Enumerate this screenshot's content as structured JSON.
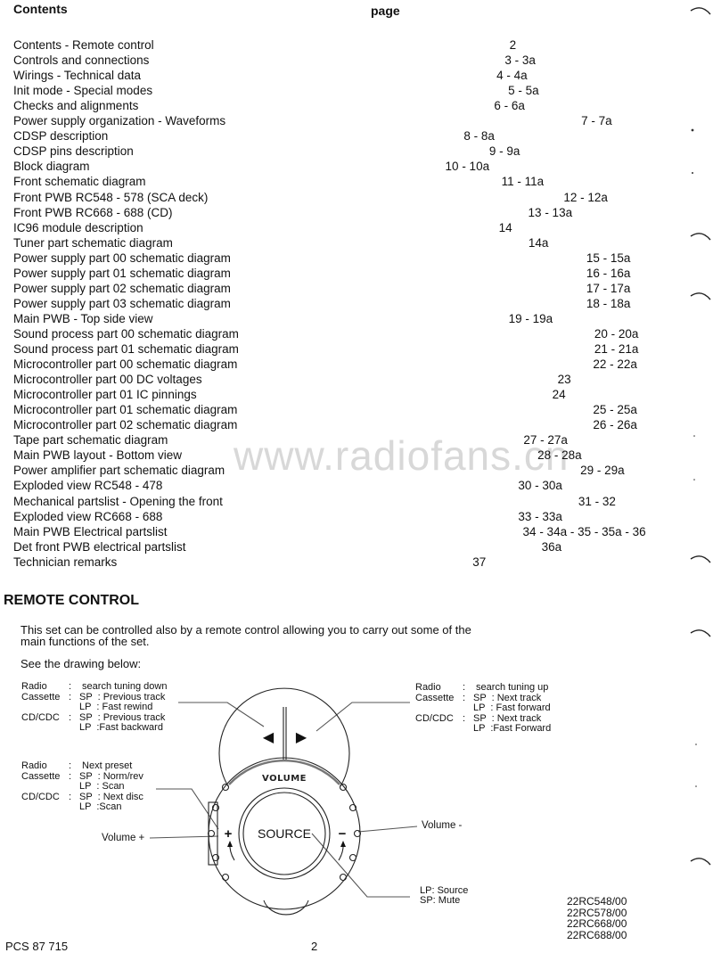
{
  "contents": {
    "heading": "Contents",
    "page_heading": "page",
    "entries": [
      {
        "title": "Contents - Remote control",
        "page": "2"
      },
      {
        "title": "Controls and connections",
        "page": "3 - 3a"
      },
      {
        "title": "Wirings - Technical data",
        "page": "4 - 4a"
      },
      {
        "title": "Init mode - Special modes",
        "page": "5 - 5a"
      },
      {
        "title": "Checks and alignments",
        "page": "6 - 6a"
      },
      {
        "title": "Power supply organization - Waveforms",
        "page": "7 - 7a"
      },
      {
        "title": "CDSP description",
        "page": "8 - 8a"
      },
      {
        "title": "CDSP pins description",
        "page": "9 - 9a"
      },
      {
        "title": "Block diagram",
        "page": "10 - 10a"
      },
      {
        "title": "Front schematic diagram",
        "page": "11 - 11a"
      },
      {
        "title": "Front PWB RC548 - 578 (SCA deck)",
        "page": "12 - 12a"
      },
      {
        "title": "Front PWB RC668 - 688 (CD)",
        "page": "13 - 13a"
      },
      {
        "title": "IC96 module description",
        "page": "14"
      },
      {
        "title": "Tuner part schematic diagram",
        "page": "14a"
      },
      {
        "title": "Power supply part 00 schematic diagram",
        "page": "15 - 15a"
      },
      {
        "title": "Power supply part 01 schematic diagram",
        "page": "16 - 16a"
      },
      {
        "title": "Power supply part 02 schematic diagram",
        "page": "17 - 17a"
      },
      {
        "title": "Power supply part 03 schematic diagram",
        "page": "18 - 18a"
      },
      {
        "title": "Main PWB - Top side view",
        "page": "19 - 19a"
      },
      {
        "title": "Sound process part 00 schematic diagram",
        "page": "20 - 20a"
      },
      {
        "title": "Sound process part 01 schematic diagram",
        "page": "21 - 21a"
      },
      {
        "title": "Microcontroller part 00 schematic diagram",
        "page": "22 - 22a"
      },
      {
        "title": "Microcontroller part 00 DC voltages",
        "page": "23"
      },
      {
        "title": "Microcontroller part 01 IC pinnings",
        "page": "24"
      },
      {
        "title": "Microcontroller part 01 schematic diagram",
        "page": "25 - 25a"
      },
      {
        "title": "Microcontroller part 02 schematic diagram",
        "page": "26 - 26a"
      },
      {
        "title": "Tape part schematic diagram",
        "page": "27 - 27a"
      },
      {
        "title": "Main PWB layout - Bottom view",
        "page": "28 - 28a"
      },
      {
        "title": "Power amplifier part schematic diagram",
        "page": "29 - 29a"
      },
      {
        "title": "Exploded view RC548 - 478",
        "page": "30 - 30a"
      },
      {
        "title": "Mechanical partslist - Opening the front",
        "page": "31 - 32"
      },
      {
        "title": "Exploded view RC668 - 688",
        "page": "33 - 33a"
      },
      {
        "title": "Main PWB Electrical partslist",
        "page": "34 - 34a - 35 - 35a - 36"
      },
      {
        "title": "Det front PWB electrical partslist",
        "page": "36a"
      },
      {
        "title": "Technician remarks",
        "page": "37"
      }
    ]
  },
  "watermark": "www.radiofans.cn",
  "remote": {
    "title": "REMOTE CONTROL",
    "intro_line1": "This set can be controlled also by a remote control allowing you to carry out some of the",
    "intro_line2": "main functions of the set.",
    "see_drawing": "See the drawing below:",
    "drawing": {
      "volume_label": "VOLUME",
      "source_label": "SOURCE",
      "plus_symbol": "+",
      "minus_symbol": "−",
      "prev_symbol": "◀",
      "next_symbol": "▶"
    },
    "prev_button_notes": [
      {
        "c1": "Radio",
        "c2": ":",
        "c3": " search tuning down"
      },
      {
        "c1": "Cassette",
        "c2": ":",
        "c3": "SP  : Previous track"
      },
      {
        "c1": "",
        "c2": "",
        "c3": "LP  : Fast rewind"
      },
      {
        "c1": "CD/CDC",
        "c2": ":",
        "c3": "SP  : Previous track"
      },
      {
        "c1": "",
        "c2": "",
        "c3": "LP  :Fast backward"
      }
    ],
    "next_button_notes": [
      {
        "c1": "Radio",
        "c2": ":",
        "c3": " search tuning up"
      },
      {
        "c1": "Cassette",
        "c2": ":",
        "c3": "SP  : Next track"
      },
      {
        "c1": "",
        "c2": "",
        "c3": "LP  : Fast forward"
      },
      {
        "c1": "CD/CDC",
        "c2": ":",
        "c3": "SP  : Next track"
      },
      {
        "c1": "",
        "c2": "",
        "c3": "LP  :Fast Forward"
      }
    ],
    "side_button_notes": [
      {
        "c1": "Radio",
        "c2": ":",
        "c3": " Next preset"
      },
      {
        "c1": "Cassette",
        "c2": ":",
        "c3": "SP  : Norm/rev"
      },
      {
        "c1": "",
        "c2": "",
        "c3": "LP  : Scan"
      },
      {
        "c1": "CD/CDC",
        "c2": ":",
        "c3": "SP  : Next disc"
      },
      {
        "c1": "",
        "c2": "",
        "c3": "LP  :Scan"
      }
    ],
    "volume_plus_label": "Volume +",
    "volume_minus_label": "Volume -",
    "source_notes": [
      "LP: Source",
      "SP: Mute"
    ]
  },
  "models": [
    "22RC548/00",
    "22RC578/00",
    "22RC668/00",
    "22RC688/00"
  ],
  "footer": {
    "doc_code": "PCS 87 715",
    "page_number": "2"
  }
}
